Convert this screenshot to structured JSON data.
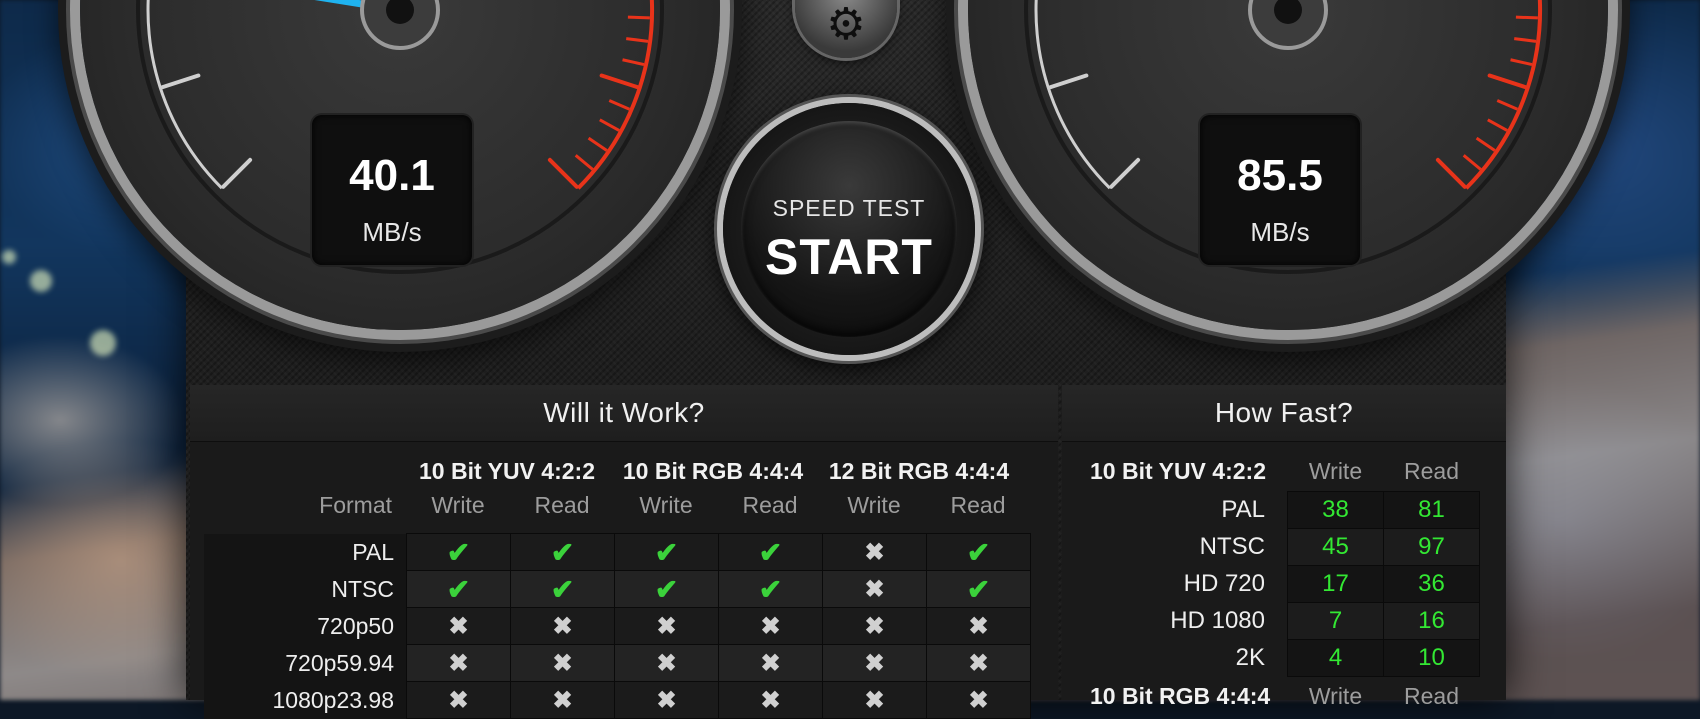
{
  "write_gauge": {
    "value": "40.1",
    "unit": "MB/s",
    "needle_fraction": 0.2
  },
  "read_gauge": {
    "value": "85.5",
    "unit": "MB/s",
    "needle_fraction": 0.43
  },
  "settings": {
    "icon": "gear-icon"
  },
  "start_button": {
    "subtitle": "SPEED TEST",
    "label": "START"
  },
  "will_it_work": {
    "title": "Will it Work?",
    "format_label": "Format",
    "groups": [
      "10 Bit YUV 4:2:2",
      "10 Bit RGB 4:4:4",
      "12 Bit RGB 4:4:4"
    ],
    "write_label": "Write",
    "read_label": "Read",
    "rows": [
      {
        "format": "PAL",
        "results": [
          "✔",
          "✔",
          "✔",
          "✔",
          "✖",
          "✔"
        ]
      },
      {
        "format": "NTSC",
        "results": [
          "✔",
          "✔",
          "✔",
          "✔",
          "✖",
          "✔"
        ]
      },
      {
        "format": "720p50",
        "results": [
          "✖",
          "✖",
          "✖",
          "✖",
          "✖",
          "✖"
        ]
      },
      {
        "format": "720p59.94",
        "results": [
          "✖",
          "✖",
          "✖",
          "✖",
          "✖",
          "✖"
        ]
      },
      {
        "format": "1080p23.98",
        "results": [
          "✖",
          "✖",
          "✖",
          "✖",
          "✖",
          "✖"
        ]
      }
    ]
  },
  "how_fast": {
    "title": "How Fast?",
    "group1": "10 Bit YUV 4:2:2",
    "group2": "10 Bit RGB 4:4:4",
    "write_label": "Write",
    "read_label": "Read",
    "rows": [
      {
        "format": "PAL",
        "write": "38",
        "read": "81"
      },
      {
        "format": "NTSC",
        "write": "45",
        "read": "97"
      },
      {
        "format": "HD 720",
        "write": "17",
        "read": "36"
      },
      {
        "format": "HD 1080",
        "write": "7",
        "read": "16"
      },
      {
        "format": "2K",
        "write": "4",
        "read": "10"
      }
    ]
  },
  "colors": {
    "needle": "#1fb3f0",
    "redline": "#e8331a",
    "ok": "#3bd23b",
    "speed_value": "#33e833"
  }
}
